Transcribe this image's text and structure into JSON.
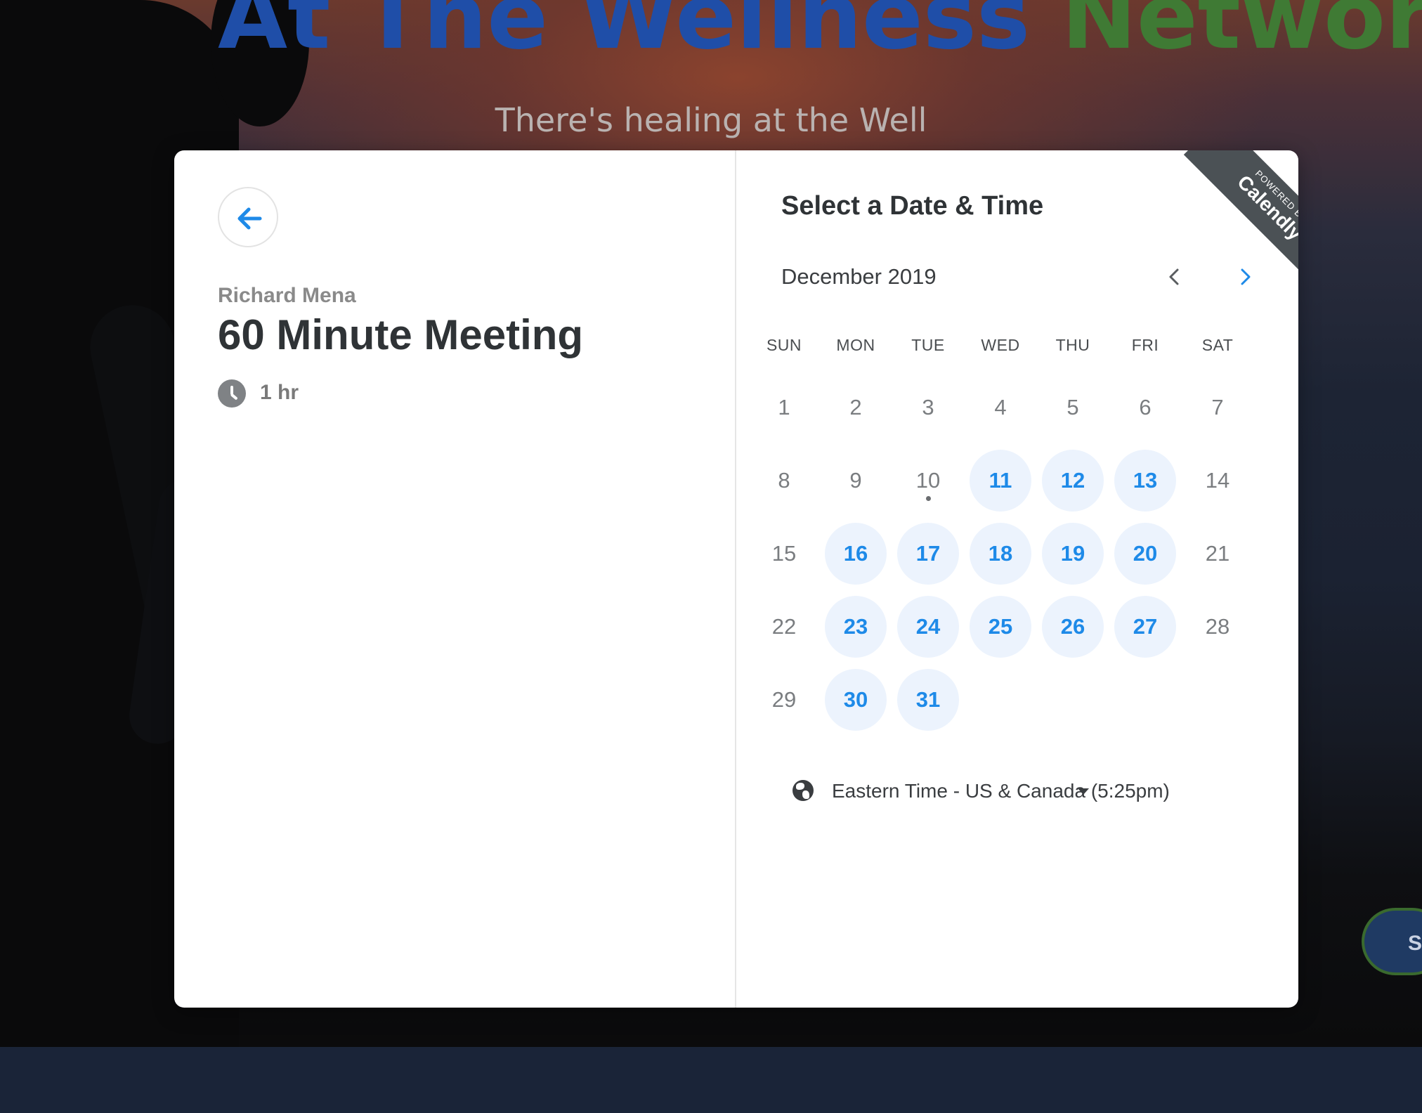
{
  "site": {
    "title_part1": "At The Wellness ",
    "title_part2": "Network",
    "tagline": "There's healing at the Well",
    "side_button_label": "S"
  },
  "event": {
    "organizer": "Richard Mena",
    "title": "60 Minute Meeting",
    "duration": "1 hr"
  },
  "calendar": {
    "heading": "Select a Date & Time",
    "month_label": "December 2019",
    "weekdays": [
      "SUN",
      "MON",
      "TUE",
      "WED",
      "THU",
      "FRI",
      "SAT"
    ],
    "first_weekday_index": 0,
    "days_in_month": 31,
    "today": 10,
    "available_days": [
      11,
      12,
      13,
      16,
      17,
      18,
      19,
      20,
      23,
      24,
      25,
      26,
      27,
      30,
      31
    ],
    "timezone_label": "Eastern Time - US & Canada (5:25pm)"
  },
  "ribbon": {
    "small_text": "POWERED BY",
    "brand": "Calendly",
    "color": "#4b5155"
  },
  "colors": {
    "accent": "#1e8ae8",
    "available_bg": "#ecf3fd",
    "title_blue": "#1f4ea8",
    "title_green": "#3f7a34"
  },
  "icons": {
    "back": "arrow-left-icon",
    "duration": "clock-icon",
    "prev_month": "chevron-left-icon",
    "next_month": "chevron-right-icon",
    "timezone": "globe-icon",
    "timezone_dropdown": "caret-down-icon"
  }
}
